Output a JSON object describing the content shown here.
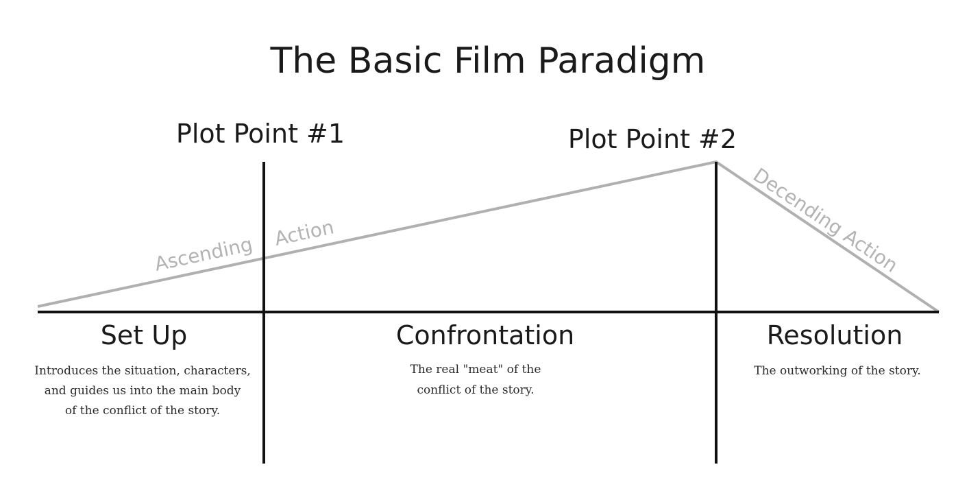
{
  "title": "The Basic Film Paradigm",
  "plot_points": {
    "one": "Plot Point #1",
    "two": "Plot Point #2"
  },
  "action_labels": {
    "ascending_1": "Ascending",
    "ascending_2": "Action",
    "descending": "Decending Action"
  },
  "acts": {
    "setup": {
      "title": "Set Up",
      "desc": [
        "Introduces the situation, characters,",
        "and guides us into the main body",
        "of the conflict of the story."
      ]
    },
    "confrontation": {
      "title": "Confrontation",
      "desc": [
        "The real \"meat\" of the",
        "conflict of the story."
      ]
    },
    "resolution": {
      "title": "Resolution",
      "desc": [
        "The outworking of the story."
      ]
    }
  },
  "colors": {
    "line_dark": "#111111",
    "line_gray": "#b0b0b0",
    "label_gray": "#b3b3b3"
  }
}
